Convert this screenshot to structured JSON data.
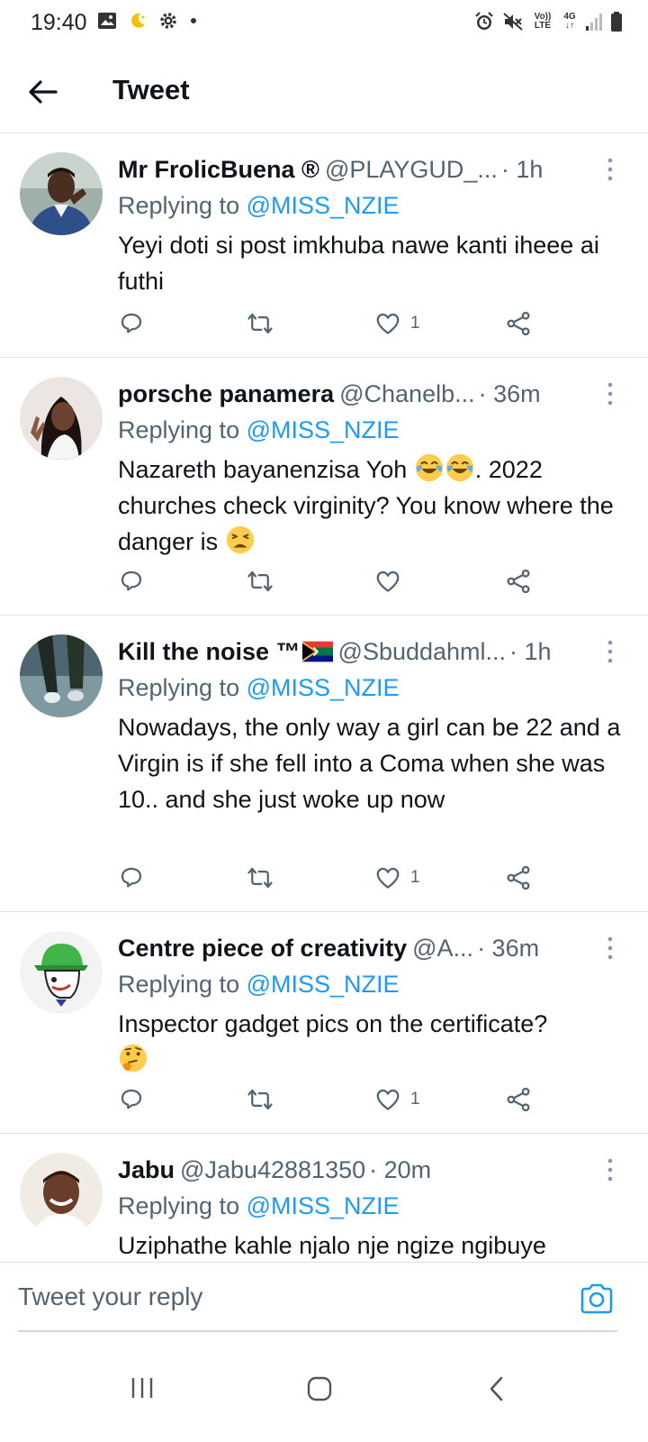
{
  "status_bar": {
    "time": "19:40",
    "left_icons": [
      "image-icon",
      "moon-icon",
      "gear-icon",
      "dot-icon"
    ],
    "right_icons": [
      "alarm-icon",
      "mute-icon",
      "volte-icon",
      "4g-icon",
      "signal-icon",
      "battery-icon"
    ],
    "volte_text": "Vo)) LTE",
    "network_text": "4G"
  },
  "header": {
    "title": "Tweet"
  },
  "colors": {
    "link": "#1d9bf0",
    "secondary": "#536471",
    "divider": "#dfe3e7"
  },
  "tweets": [
    {
      "name": "Mr FrolicBuena ®",
      "handle": "@PLAYGUD_...",
      "time": "· 1h",
      "replying_label": "Replying to",
      "replying_to": "@MISS_NZIE",
      "text": "Yeyi doti si post imkhuba nawe kanti iheee ai futhi",
      "like_count": "1"
    },
    {
      "name": "porsche panamera",
      "handle": "@Chanelb...",
      "time": "· 36m",
      "replying_label": "Replying to",
      "replying_to": "@MISS_NZIE",
      "text_a": "Nazareth bayanenzisa Yoh",
      "text_b": ". 2022 churches check virginity? You know where the danger is",
      "like_count": ""
    },
    {
      "name": "Kill the noise ™",
      "handle": "@Sbuddahml...",
      "time": "· 1h",
      "replying_label": "Replying to",
      "replying_to": "@MISS_NZIE",
      "text": "Nowadays, the only way a girl can be 22 and a Virgin is if she fell into a Coma when she was 10.. and she just woke up now",
      "like_count": "1"
    },
    {
      "name": "Centre piece of creativity",
      "handle": "@A...",
      "time": "· 36m",
      "replying_label": "Replying to",
      "replying_to": "@MISS_NZIE",
      "text": "Inspector gadget pics on the certificate?",
      "like_count": "1"
    },
    {
      "name": "Jabu",
      "handle": "@Jabu42881350",
      "time": "· 20m",
      "replying_label": "Replying to",
      "replying_to": "@MISS_NZIE",
      "text": "Uziphathe kahle njalo nje ngize ngibuye",
      "like_count": ""
    }
  ],
  "reply_bar": {
    "placeholder": "Tweet your reply"
  },
  "nav": [
    "recents-button",
    "home-button",
    "back-button"
  ]
}
